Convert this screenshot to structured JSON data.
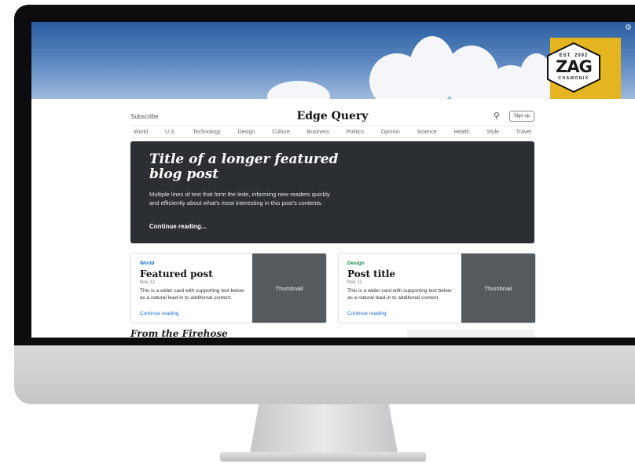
{
  "banner": {
    "badge": {
      "est": "EST. 2002",
      "brand": "ZAG",
      "location": "CHAMONIX"
    },
    "icon": "settings-icon"
  },
  "blog": {
    "subscribe_label": "Subscribe",
    "brand": "Edge Query",
    "search_icon": "search-icon",
    "signup_label": "Sign up",
    "nav": [
      "World",
      "U.S.",
      "Technology",
      "Design",
      "Culture",
      "Business",
      "Politics",
      "Opinion",
      "Science",
      "Health",
      "Style",
      "Travel"
    ],
    "hero": {
      "title": "Title of a longer featured blog post",
      "lede": "Multiple lines of text that form the lede, informing new readers quickly and efficiently about what's most interesting in this post's contents.",
      "link": "Continue reading..."
    },
    "cards": [
      {
        "category": "World",
        "category_color": "#1a6fd6",
        "title": "Featured post",
        "date": "Nov 12",
        "text": "This is a wider card with supporting text below as a natural lead-in to additional content.",
        "link": "Continue reading",
        "thumb": "Thumbnail"
      },
      {
        "category": "Design",
        "category_color": "#1f8a4c",
        "title": "Post title",
        "date": "Nov 11",
        "text": "This is a wider card with supporting text below as a natural lead-in to additional content.",
        "link": "Continue reading",
        "thumb": "Thumbnail"
      }
    ],
    "section_heading": "From the Firehose"
  }
}
